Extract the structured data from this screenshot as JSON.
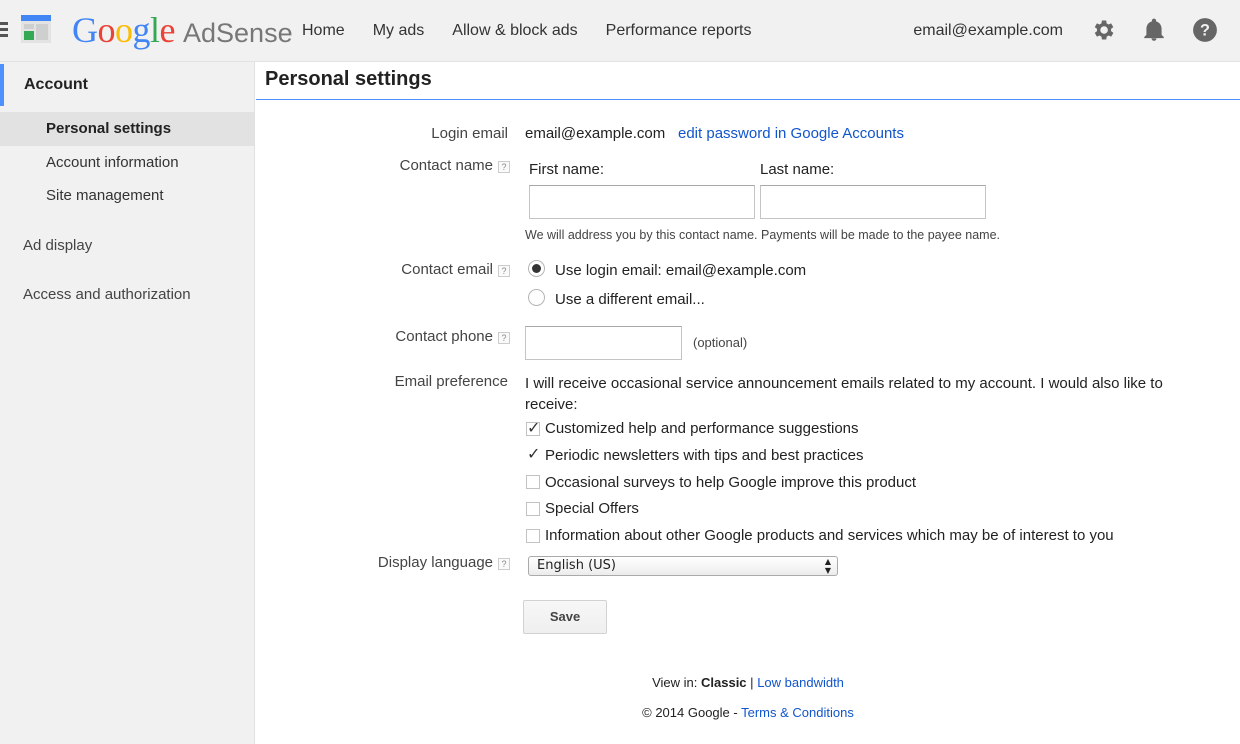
{
  "header": {
    "logo_google": "Google",
    "logo_product": "AdSense",
    "nav": [
      "Home",
      "My ads",
      "Allow & block ads",
      "Performance reports"
    ],
    "account_email": "email@example.com",
    "icons": [
      "gear-icon",
      "bell-icon",
      "help-icon"
    ]
  },
  "sidebar": {
    "section": "Account",
    "items": [
      "Personal settings",
      "Account information",
      "Site management"
    ],
    "active_item": "Personal settings",
    "other_sections": [
      "Ad display",
      "Access and authorization"
    ]
  },
  "page": {
    "title": "Personal settings"
  },
  "form": {
    "login_email": {
      "label": "Login email",
      "value": "email@example.com",
      "link": "edit password in Google Accounts"
    },
    "contact_name": {
      "label": "Contact name",
      "first_label": "First name:",
      "last_label": "Last name:",
      "first_value": "",
      "last_value": "",
      "hint": "We will address you by this contact name. Payments will be made to the payee name."
    },
    "contact_email": {
      "label": "Contact email",
      "option_login": "Use login email: email@example.com",
      "option_different": "Use a different email...",
      "selected": "login"
    },
    "contact_phone": {
      "label": "Contact phone",
      "value": "",
      "note": "(optional)"
    },
    "email_preference": {
      "label": "Email preference",
      "intro": "I will receive occasional service announcement emails related to my account. I would also like to receive:",
      "options": [
        {
          "label": "Customized help and performance suggestions",
          "checked": true
        },
        {
          "label": "Periodic newsletters with tips and best practices",
          "checked": true
        },
        {
          "label": "Occasional surveys to help Google improve this product",
          "checked": false
        },
        {
          "label": "Special Offers",
          "checked": false
        },
        {
          "label": "Information about other Google products and services which may be of interest to you",
          "checked": false
        }
      ]
    },
    "display_language": {
      "label": "Display language",
      "selected": "English (US)"
    },
    "help_glyph": "?",
    "save_label": "Save"
  },
  "footer": {
    "view_in": "View in:",
    "classic": "Classic",
    "separator": "|",
    "low_bandwidth": "Low bandwidth",
    "copyright": "© 2014 Google -",
    "terms": "Terms & Conditions"
  },
  "colors": {
    "accent": "#4d90fe",
    "link": "#1155cc",
    "google_blue": "#4285f4",
    "google_red": "#ea4335",
    "google_yellow": "#fbbc05",
    "google_green": "#34a853"
  }
}
